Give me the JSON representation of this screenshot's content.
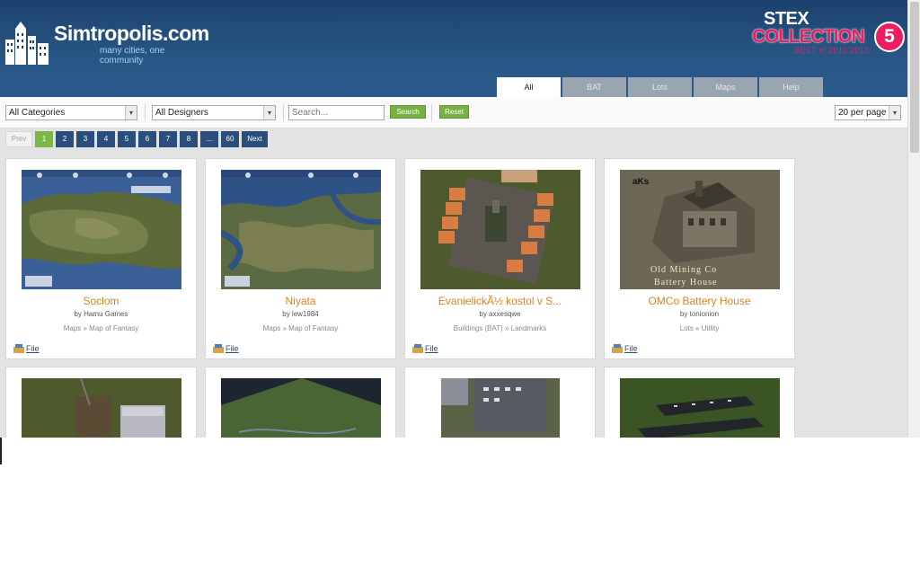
{
  "header": {
    "site_name": "Simtropolis.com",
    "tagline": "many cities, one community",
    "stex": {
      "title": "STEX",
      "collection": "COLLECTION",
      "badge": "5",
      "subtitle": "BEST of 2011-2013"
    }
  },
  "tabs": [
    {
      "label": "All",
      "active": true
    },
    {
      "label": "BAT"
    },
    {
      "label": "Lots"
    },
    {
      "label": "Maps"
    },
    {
      "label": "Help"
    }
  ],
  "filters": {
    "category": "All Categories",
    "designer": "All Designers",
    "search_placeholder": "Search...",
    "search_button": "Search",
    "reset_button": "Reset",
    "per_page": "20 per page"
  },
  "pagination": {
    "prev": "Prev",
    "pages": [
      "1",
      "2",
      "3",
      "4",
      "5",
      "6",
      "7",
      "8",
      "...",
      "60"
    ],
    "current": "1",
    "next": "Next"
  },
  "cards": [
    {
      "title": "Soclom",
      "author": "by Hamu Games",
      "category": "Maps » Map of Fantasy",
      "file": "File"
    },
    {
      "title": "Niyata",
      "author": "by lew1984",
      "category": "Maps » Map of Fantasy",
      "file": "File"
    },
    {
      "title": "EvanielickÃ½ kostol v S...",
      "author": "by axxesqwe",
      "category": "Buildings (BAT) » Landmarks",
      "file": "File"
    },
    {
      "title": "OMCo Battery House",
      "author": "by tonionion",
      "category": "Lots » Utility",
      "file": "File"
    },
    {
      "title": "",
      "author": "",
      "category": "",
      "file": ""
    },
    {
      "title": "",
      "author": "",
      "category": "",
      "file": ""
    },
    {
      "title": "",
      "author": "",
      "category": "",
      "file": ""
    },
    {
      "title": "",
      "author": "",
      "category": "",
      "file": ""
    }
  ],
  "thumbnails": {
    "card4_overlay_top": "aKs",
    "card4_overlay_line1": "Old Mining Co",
    "card4_overlay_line2": "Battery House"
  },
  "icons": {
    "file_icon": "file-download-icon",
    "select_arrow": "chevron-down-icon"
  },
  "colors": {
    "header_bg": "#275584",
    "accent_orange": "#e0811e",
    "accent_green": "#77b043",
    "stex_pink": "#e91e63",
    "pager_blue": "#2b4f7c"
  }
}
